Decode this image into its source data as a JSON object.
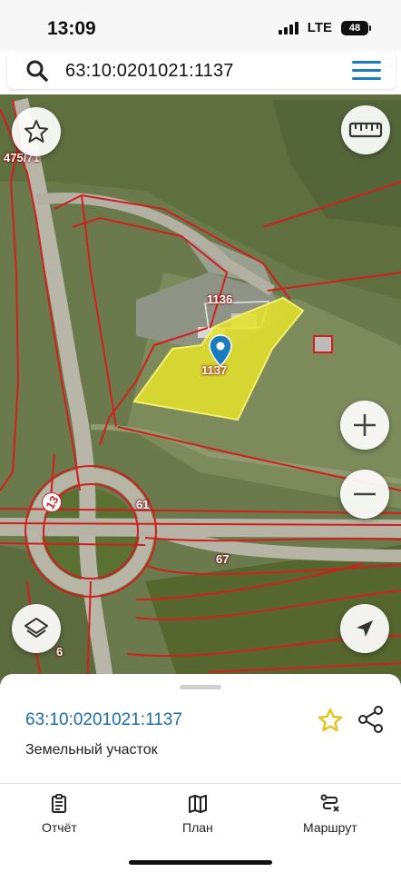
{
  "status_bar": {
    "time": "13:09",
    "network": "LTE",
    "battery": "48"
  },
  "search": {
    "query": "63:10:0201021:1137",
    "icon": "search-icon"
  },
  "map": {
    "parcel_labels": [
      "475/71",
      "1136",
      "1137"
    ],
    "road_labels_circle": [
      "13"
    ],
    "road_labels_plain": [
      "61",
      "67",
      "6"
    ],
    "selected_parcel_color": "#e5e32a",
    "boundary_color": "#d11f1f"
  },
  "sheet": {
    "title": "63:10:0201021:1137",
    "subtitle": "Земельный участок"
  },
  "tabs": [
    {
      "label": "Отчёт",
      "icon": "report-icon"
    },
    {
      "label": "План",
      "icon": "map-plan-icon"
    },
    {
      "label": "Маршрут",
      "icon": "route-icon"
    }
  ],
  "colors": {
    "accent": "#1a7bbf",
    "star": "#e8c21a"
  }
}
